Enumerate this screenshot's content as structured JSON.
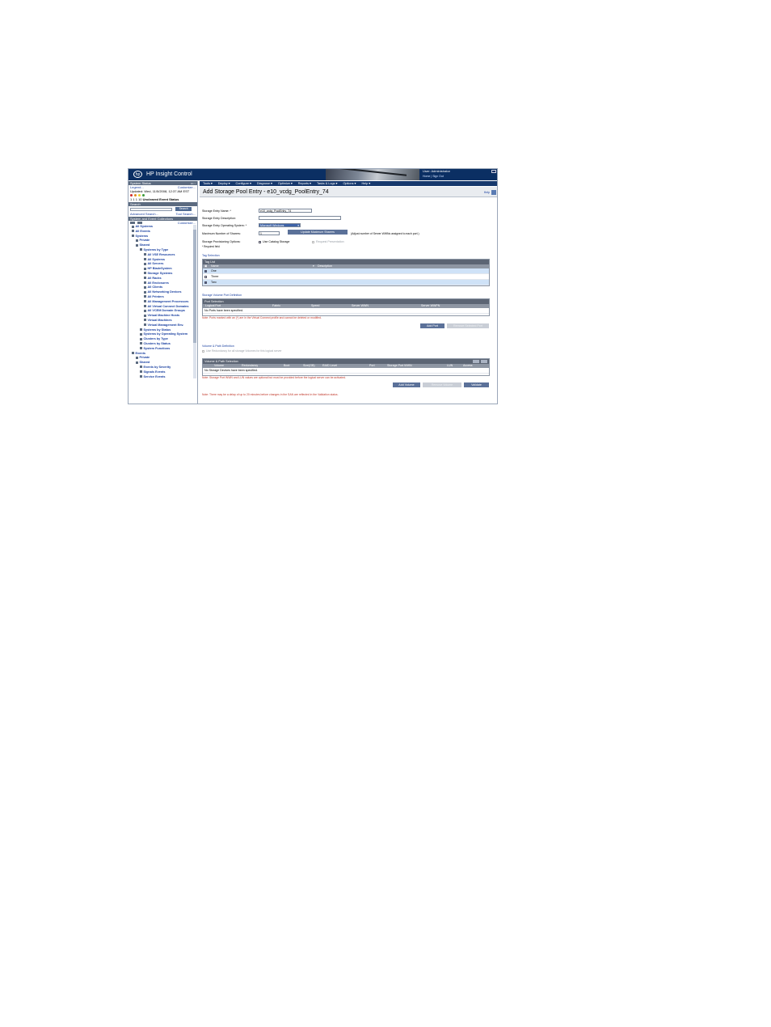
{
  "header": {
    "logo_text": "hp",
    "app_title": "HP Insight Control",
    "user_label": "User: Administrator",
    "links": "Home | Sign Out"
  },
  "left_panel": {
    "system_status": {
      "title": "System Status",
      "legend": "Legend...",
      "customize": "Customize...",
      "updated": "Updated: Wed, 11/5/2008, 12:37 AM EST",
      "uncleared_label": "Uncleared Event Status",
      "status_counts": [
        "1",
        "1",
        "1",
        "10"
      ]
    },
    "search": {
      "title": "Search",
      "button": "Search",
      "advanced": "Advanced Search...",
      "tool_search": "Tool Search..."
    },
    "collections": {
      "title": "System and Event Collections",
      "customize": "Customize...",
      "items": [
        {
          "label": "All Systems",
          "depth": 0
        },
        {
          "label": "All Events",
          "depth": 0
        },
        {
          "label": "Systems",
          "depth": 0
        },
        {
          "label": "Private",
          "depth": 1
        },
        {
          "label": "Shared",
          "depth": 1
        },
        {
          "label": "Systems by Type",
          "depth": 2
        },
        {
          "label": "All VSE Resources",
          "depth": 3
        },
        {
          "label": "All Systems",
          "depth": 3
        },
        {
          "label": "All Servers",
          "depth": 3
        },
        {
          "label": "HP BladeSystem",
          "depth": 3
        },
        {
          "label": "Storage Systems",
          "depth": 3
        },
        {
          "label": "All Racks",
          "depth": 3
        },
        {
          "label": "All Enclosures",
          "depth": 3
        },
        {
          "label": "All Clients",
          "depth": 3
        },
        {
          "label": "All Networking Devices",
          "depth": 3
        },
        {
          "label": "All Printers",
          "depth": 3
        },
        {
          "label": "All Management Processors",
          "depth": 3
        },
        {
          "label": "All Virtual Connect Domains",
          "depth": 3
        },
        {
          "label": "All VCEM Domain Groups",
          "depth": 3
        },
        {
          "label": "Virtual Machine Hosts",
          "depth": 3
        },
        {
          "label": "Virtual Machines",
          "depth": 3
        },
        {
          "label": "Virtual Management Env.",
          "depth": 3
        },
        {
          "label": "Systems by Status",
          "depth": 2
        },
        {
          "label": "Systems by Operating System",
          "depth": 2
        },
        {
          "label": "Clusters by Type",
          "depth": 2
        },
        {
          "label": "Clusters by Status",
          "depth": 2
        },
        {
          "label": "System Functions",
          "depth": 2
        },
        {
          "label": "Events",
          "depth": 0
        },
        {
          "label": "Private",
          "depth": 1
        },
        {
          "label": "Shared",
          "depth": 1
        },
        {
          "label": "Events by Severity",
          "depth": 2
        },
        {
          "label": "Signals Events",
          "depth": 2
        },
        {
          "label": "Service Events",
          "depth": 2
        }
      ]
    }
  },
  "menu": [
    "Tools",
    "Deploy",
    "Configure",
    "Diagnose",
    "Optimize",
    "Reports",
    "Tasks & Logs",
    "Options",
    "Help"
  ],
  "page": {
    "title": "Add Storage Pool Entry - e10_vcdg_PoolEntry_74",
    "help_link": "Help"
  },
  "form": {
    "name_label": "Storage Entry Name: *",
    "name_value": "e10_vcdg_PoolEntry_74",
    "desc_label": "Storage Entry Description:",
    "desc_value": "",
    "os_label": "Storage Entry Operating System: *",
    "os_value": "Microsoft Windows",
    "max_label": "Maximum Number of Sharers:",
    "max_value": "1",
    "update_button": "Update Maximum Sharers",
    "adjust_note": "(Adjust number of Server WWNs assigned to each port.)",
    "prov_label": "Storage Provisioning Options:",
    "use_catalog": "Use Catalog Storage",
    "request_presentation": "Request Presentation",
    "required_note": "* Required field"
  },
  "tag_selection": {
    "section": "Tag Selection",
    "grid_title": "Tag List",
    "col_name": "Name",
    "col_description": "Description",
    "rows": [
      {
        "name": "One",
        "checked": true
      },
      {
        "name": "Three",
        "checked": false
      },
      {
        "name": "Two",
        "checked": true
      }
    ]
  },
  "port_selection": {
    "section": "Storage Volume Port Definition",
    "grid_title": "Port Selection",
    "cols": [
      "Logical Port",
      "Fabric",
      "Speed",
      "Server WWN",
      "Server WWPN"
    ],
    "empty": "No Ports have been specified.",
    "note": "Note: Ports marked with an (*) are in the Virtual Connect profile and cannot be deleted or modified.",
    "add_button": "Add Port",
    "remove_button": "Remove Selected Port"
  },
  "volume": {
    "section": "Volume & Path Definition",
    "redundancy": "Use Redundancy for all storage Volumes for this logical server",
    "grid_title": "Volume & Path Selection",
    "cols": [
      "Volume",
      "Redundancy",
      "Boot",
      "Size(GB)",
      "RAID Level",
      "Port",
      "Storage Port WWN",
      "LUN",
      "Access"
    ],
    "empty": "No Storage Devices have been specified.",
    "note": "Note: Storage Port WWN and LUN values are optional but must be provided before the logical server can be activated.",
    "add_button": "Add Volume",
    "remove_button": "Remove Volume",
    "validate_button": "Validate",
    "bottom_note": "Note: There may be a delay of up to 20 minutes before changes in the SAN are reflected in the Validation status."
  },
  "colors": {
    "header_bg": "#0b2f63",
    "menubar_bg": "#16386d",
    "panel_head": "#5c6b80",
    "link_blue": "#1a40a0",
    "note_red": "#c0392b"
  }
}
